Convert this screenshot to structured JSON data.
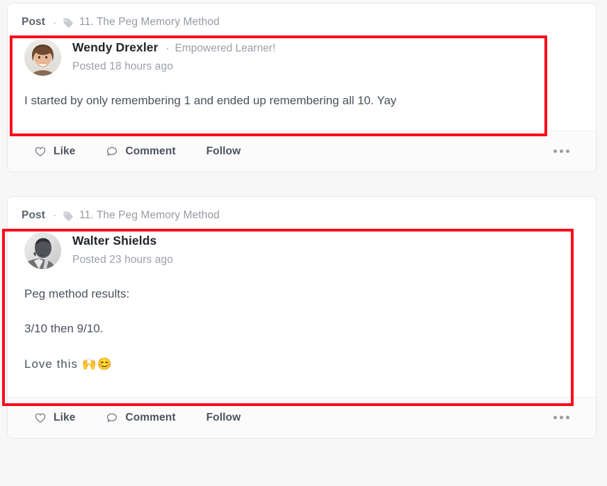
{
  "theme": {
    "page_background": "#f7f7f8",
    "card_background": "#ffffff",
    "footer_background": "#fbfbfb",
    "highlight_color": "#fc0d1b",
    "body_text_color": "#4a525e",
    "muted_text_color": "#9ba0a8"
  },
  "posts": [
    {
      "kind": "Post",
      "separator": "·",
      "tag_icon": "tag-icon",
      "tag_label": "11. The Peg Memory Method",
      "author": {
        "name": "Wendy Drexler",
        "separator": "·",
        "badge": "Empowered Learner!",
        "timestamp": "Posted 18 hours ago",
        "avatar_alt": "avatar"
      },
      "paragraphs": [
        "I started by only remembering 1 and ended up remembering all 10. Yay"
      ],
      "actions": [
        {
          "label": "Like",
          "icon": "heart-icon"
        },
        {
          "label": "Comment",
          "icon": "comment-bubble-icon"
        },
        {
          "label": "Follow",
          "icon": ""
        }
      ],
      "overflow_icon": "ellipsis-icon"
    },
    {
      "kind": "Post",
      "separator": "·",
      "tag_icon": "tag-icon",
      "tag_label": "11. The Peg Memory Method",
      "author": {
        "name": "Walter Shields",
        "separator": "",
        "badge": "",
        "timestamp": "Posted 23 hours ago",
        "avatar_alt": "avatar"
      },
      "paragraphs": [
        "Peg method results:",
        "3/10 then 9/10.",
        "Love this 🙌😊"
      ],
      "actions": [
        {
          "label": "Like",
          "icon": "heart-icon"
        },
        {
          "label": "Comment",
          "icon": "comment-bubble-icon"
        },
        {
          "label": "Follow",
          "icon": ""
        }
      ],
      "overflow_icon": "ellipsis-icon"
    }
  ]
}
